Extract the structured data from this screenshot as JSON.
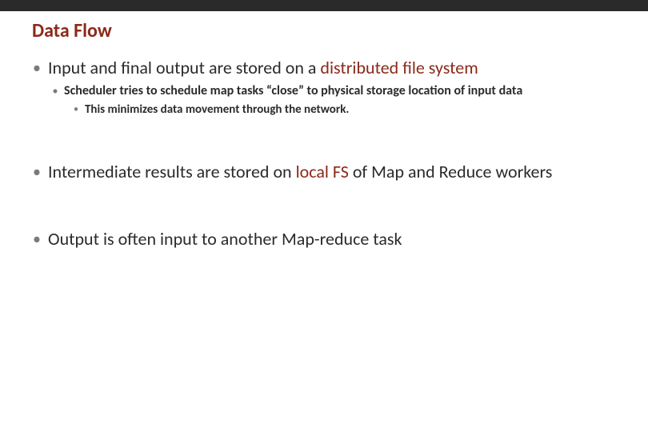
{
  "slide": {
    "title": "Data Flow",
    "bullets": {
      "b1": {
        "pre": "Input and final output are stored on a ",
        "accent": "distributed file system",
        "post": ""
      },
      "b1_1": "Scheduler tries to schedule map tasks “close” to physical storage location of input data",
      "b1_1_1": "This minimizes data movement through the network.",
      "b2": {
        "pre": "Intermediate results are stored on ",
        "accent": "local FS",
        "post": " of Map and Reduce workers"
      },
      "b3": "Output is often input to another  Map-reduce task"
    }
  }
}
